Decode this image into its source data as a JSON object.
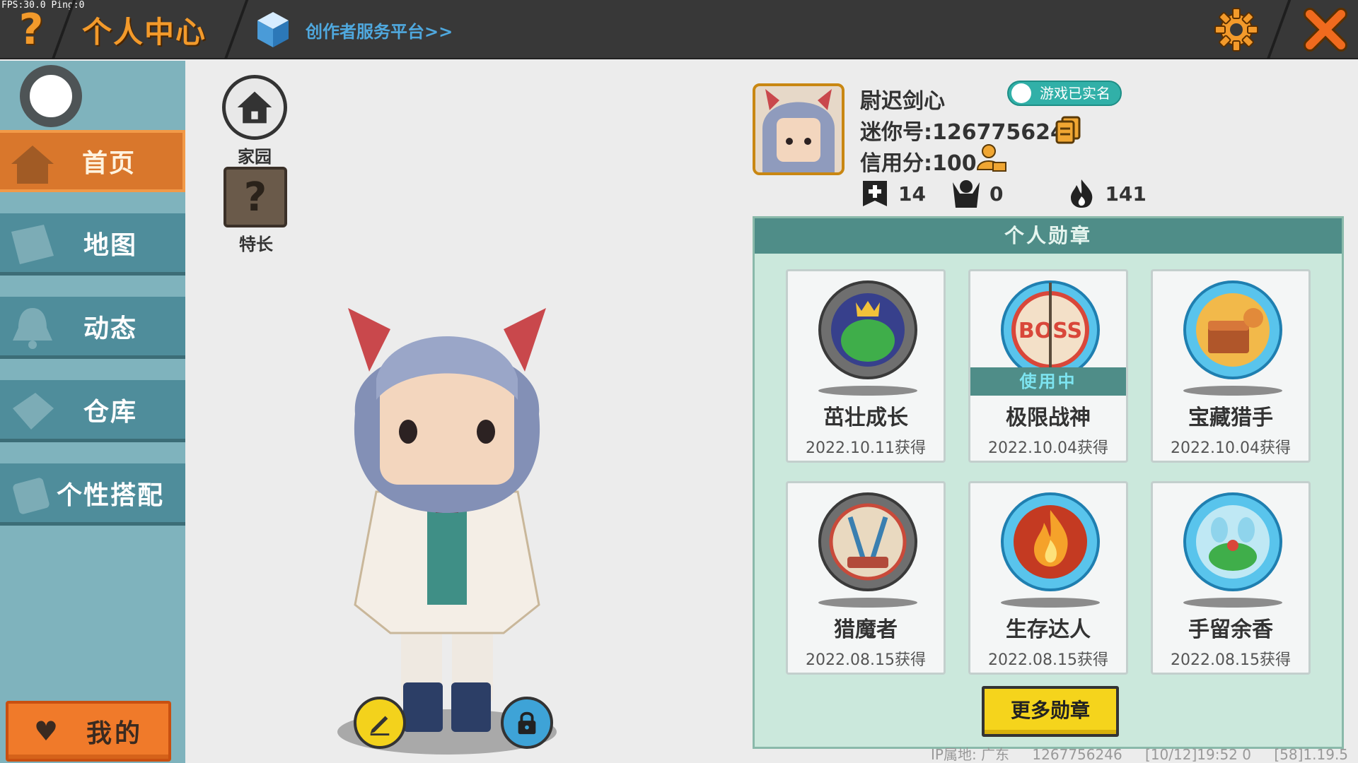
{
  "overlay": {
    "fps": "FPS:30.0 Ping:0"
  },
  "header": {
    "title": "个人中心",
    "creator_link": "创作者服务平台>>",
    "help_icon": "question-mark-icon",
    "settings_icon": "gear-icon",
    "close_icon": "close-x-icon",
    "accent_color": "#f39a2b"
  },
  "sidebar": {
    "items": [
      {
        "label": "首页",
        "icon": "house-icon",
        "active": true
      },
      {
        "label": "地图",
        "icon": "map-icon",
        "active": false
      },
      {
        "label": "动态",
        "icon": "bell-icon",
        "active": false
      },
      {
        "label": "仓库",
        "icon": "box-icon",
        "active": false
      },
      {
        "label": "个性搭配",
        "icon": "outfit-icon",
        "active": false
      }
    ],
    "mine_button": "我的"
  },
  "center": {
    "home_label": "家园",
    "skill_label": "特长"
  },
  "profile": {
    "name": "尉迟剑心",
    "verified_badge": "游戏已实名",
    "mini_id": "迷你号:1267756246",
    "credit": "信用分:100",
    "stats": [
      {
        "icon": "add-friend-icon",
        "value": "14"
      },
      {
        "icon": "fans-icon",
        "value": "0"
      },
      {
        "icon": "flame-icon",
        "value": "141"
      }
    ]
  },
  "medals": {
    "title": "个人勋章",
    "in_use_label": "使用中",
    "items": [
      {
        "name": "茁壮成长",
        "date": "2022.10.11获得",
        "in_use": false
      },
      {
        "name": "极限战神",
        "date": "2022.10.04获得",
        "in_use": true
      },
      {
        "name": "宝藏猎手",
        "date": "2022.10.04获得",
        "in_use": false
      },
      {
        "name": "猎魔者",
        "date": "2022.08.15获得",
        "in_use": false
      },
      {
        "name": "生存达人",
        "date": "2022.08.15获得",
        "in_use": false
      },
      {
        "name": "手留余香",
        "date": "2022.08.15获得",
        "in_use": false
      }
    ],
    "more_button": "更多勋章"
  },
  "footer": {
    "ip_location": "IP属地: 广东",
    "user_id": "1267756246",
    "timestamp": "[10/12]19:52 0",
    "version": "[58]1.19.5"
  }
}
